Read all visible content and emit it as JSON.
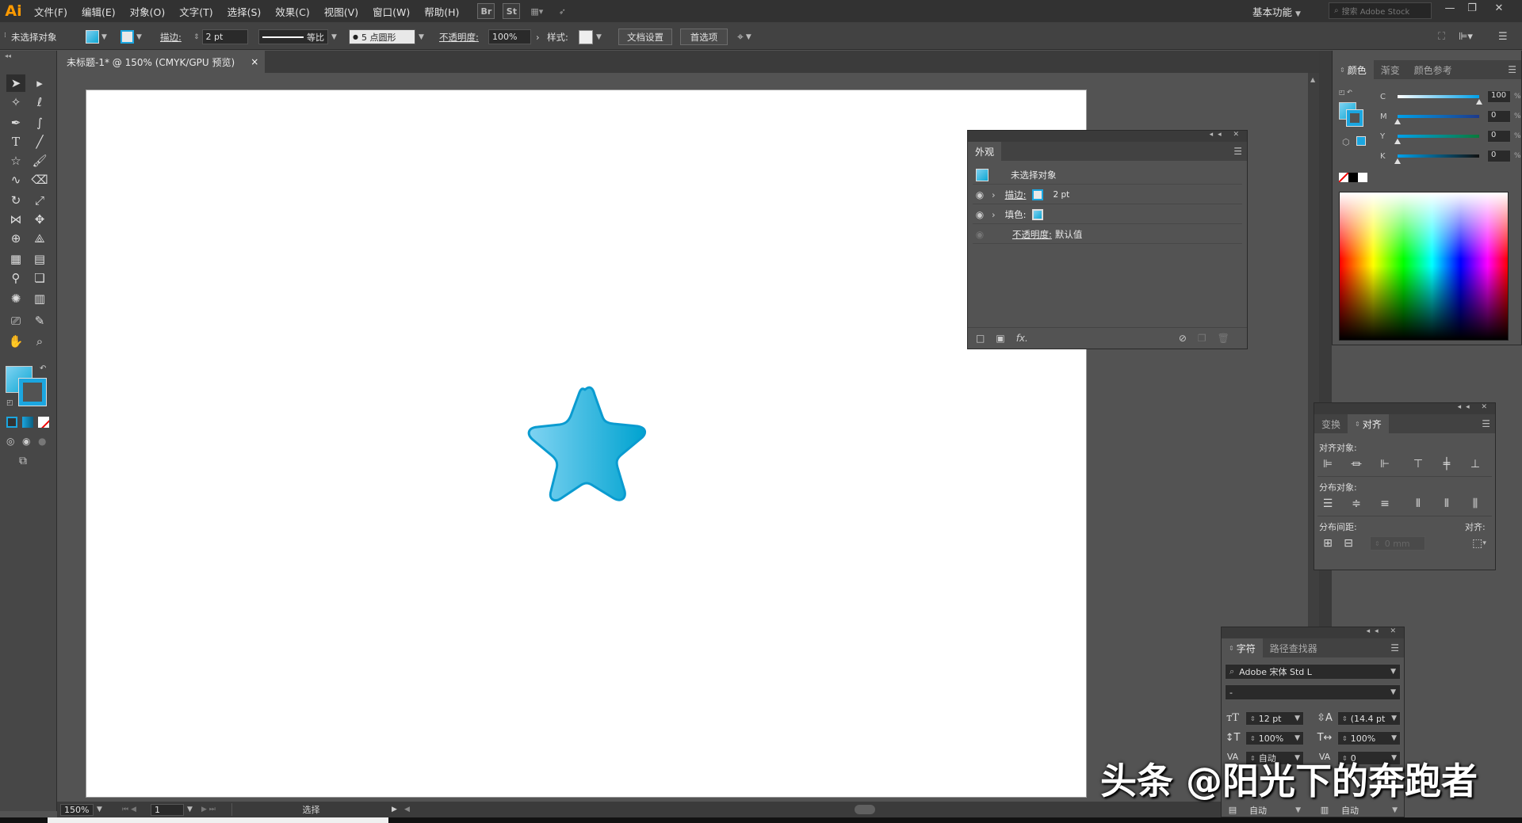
{
  "app": {
    "logo": "Ai"
  },
  "menu": [
    "文件(F)",
    "编辑(E)",
    "对象(O)",
    "文字(T)",
    "选择(S)",
    "效果(C)",
    "视图(V)",
    "窗口(W)",
    "帮助(H)"
  ],
  "menubar_icons": {
    "bridge": "Br",
    "stock": "St"
  },
  "workspace": "基本功能",
  "stock_search_placeholder": "搜索 Adobe Stock",
  "control_bar": {
    "selection_status": "未选择对象",
    "stroke_label": "描边:",
    "stroke_weight": "2 pt",
    "stroke_profile": "等比",
    "brush": "5 点圆形",
    "opacity_label": "不透明度:",
    "opacity_value": "100%",
    "style_label": "样式:",
    "doc_setup": "文档设置",
    "preferences": "首选项"
  },
  "document_tab": {
    "title": "未标题-1* @ 150% (CMYK/GPU 预览)",
    "close": "×"
  },
  "appearance_panel": {
    "tab": "外观",
    "rows": {
      "header": "未选择对象",
      "stroke_label": "描边:",
      "stroke_value": "2 pt",
      "fill_label": "填色:",
      "opacity_label": "不透明度:",
      "opacity_value": "默认值"
    },
    "fx_label": "fx."
  },
  "color_panel": {
    "tabs": [
      "颜色",
      "渐变",
      "颜色参考"
    ],
    "channels": [
      {
        "name": "C",
        "value": "100",
        "color": "#00a0e9"
      },
      {
        "name": "M",
        "value": "0",
        "color": "#e4007f"
      },
      {
        "name": "Y",
        "value": "0",
        "color": "#fff100"
      },
      {
        "name": "K",
        "value": "0",
        "color": "#000000"
      }
    ],
    "percent_sign": "%"
  },
  "align_panel": {
    "tabs": [
      "变换",
      "对齐"
    ],
    "align_objects": "对齐对象:",
    "distribute_objects": "分布对象:",
    "distribute_spacing": "分布间距:",
    "align_to": "对齐:",
    "spacing_value": "0 mm"
  },
  "character_panel": {
    "tabs": [
      "字符",
      "路径查找器"
    ],
    "font_family": "Adobe 宋体 Std L",
    "font_style": "-",
    "font_size": "12 pt",
    "leading": "(14.4 pt)",
    "vertical_scale": "100%",
    "horizontal_scale": "100%",
    "kerning": "自动",
    "tracking": "0",
    "auto_a": "自动",
    "auto_b": "自动"
  },
  "status_bar": {
    "zoom": "150%",
    "page": "1",
    "tool": "选择"
  },
  "colors": {
    "star_light": "#7fd3f2",
    "star_dark": "#00a3d0",
    "star_stroke": "#0a9bd0",
    "accent": "#1ba6e0"
  },
  "watermark": "头条 @阳光下的奔跑者"
}
